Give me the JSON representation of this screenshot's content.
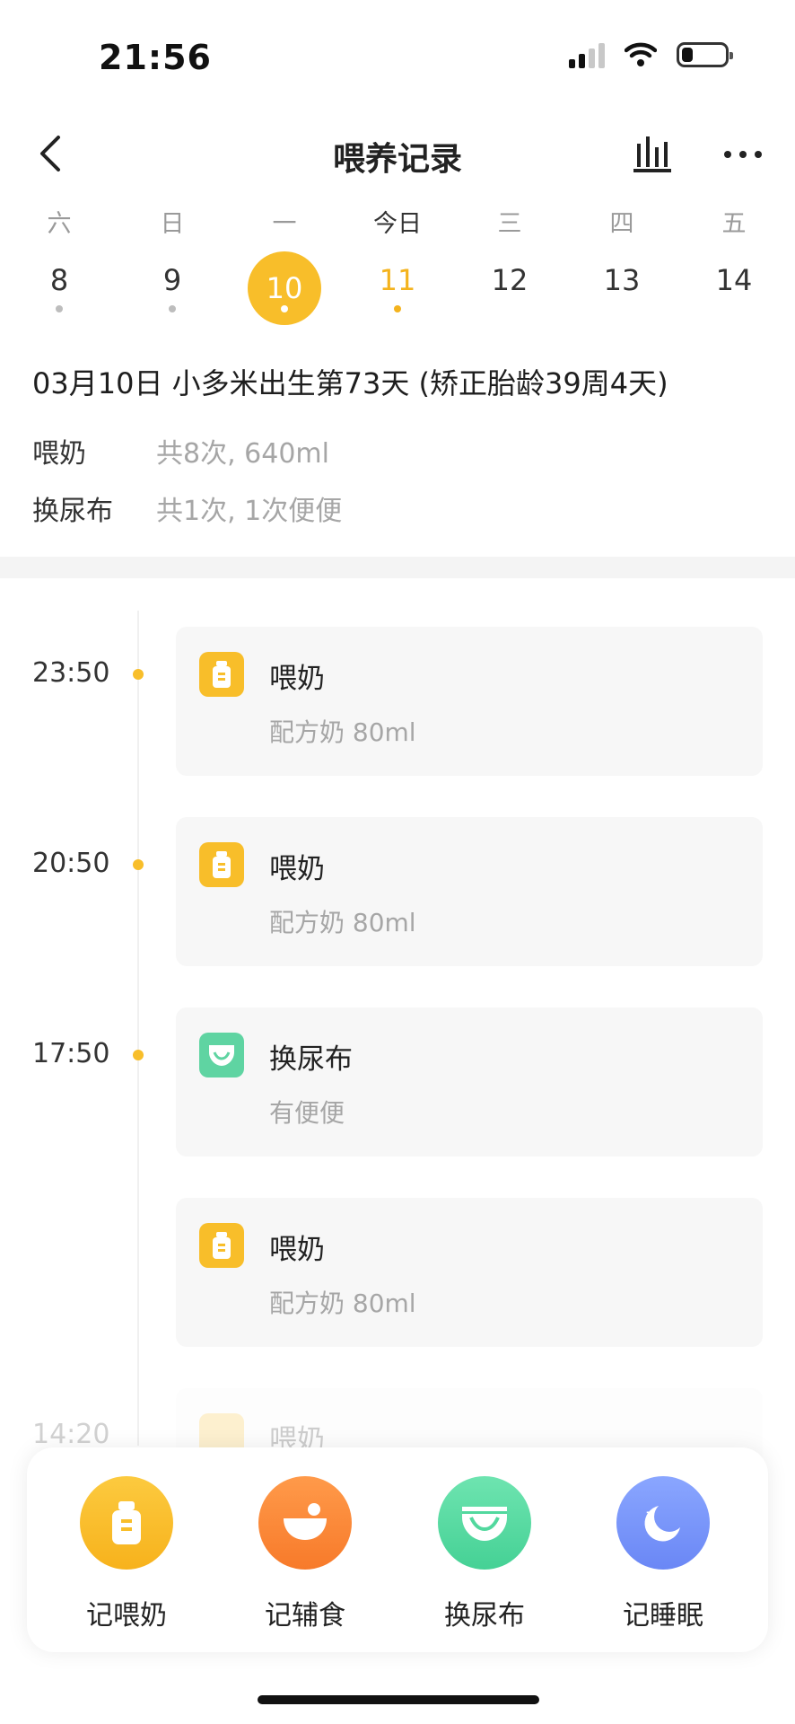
{
  "status": {
    "time": "21:56",
    "battery_level": 0.25
  },
  "nav": {
    "title": "喂养记录",
    "icons": [
      "back-icon",
      "bar-chart-icon",
      "more-icon"
    ]
  },
  "week": {
    "days": [
      {
        "weekday": "六",
        "date": "8",
        "dot": "gray"
      },
      {
        "weekday": "日",
        "date": "9",
        "dot": "gray"
      },
      {
        "weekday": "一",
        "date": "10",
        "dot": "white",
        "selected": true
      },
      {
        "weekday": "今日",
        "date": "11",
        "dot": "yellow",
        "today": true
      },
      {
        "weekday": "三",
        "date": "12"
      },
      {
        "weekday": "四",
        "date": "13"
      },
      {
        "weekday": "五",
        "date": "14"
      }
    ]
  },
  "summary": {
    "title": "03月10日  小多米出生第73天 (矫正胎龄39周4天)",
    "rows": [
      {
        "label": "喂奶",
        "value": "共8次, 640ml"
      },
      {
        "label": "换尿布",
        "value": "共1次, 1次便便"
      }
    ]
  },
  "timeline": [
    {
      "time": "23:50",
      "type": "feed",
      "title": "喂奶",
      "detail": "配方奶 80ml"
    },
    {
      "time": "20:50",
      "type": "feed",
      "title": "喂奶",
      "detail": "配方奶 80ml"
    },
    {
      "time": "17:50",
      "type": "diaper",
      "title": "换尿布",
      "detail": "有便便"
    },
    {
      "time": "",
      "type": "feed",
      "title": "喂奶",
      "detail": "配方奶 80ml"
    },
    {
      "time": "14:20",
      "type": "feed",
      "title": "喂奶",
      "detail": ""
    }
  ],
  "actions": [
    {
      "label": "记喂奶",
      "icon": "bottle-icon",
      "color": "#f8be2a"
    },
    {
      "label": "记辅食",
      "icon": "bowl-icon",
      "color": "#f7832f"
    },
    {
      "label": "换尿布",
      "icon": "diaper-icon",
      "color": "#52d89e"
    },
    {
      "label": "记睡眠",
      "icon": "moon-icon",
      "color": "#7594f8"
    }
  ],
  "colors": {
    "accent": "#f8be2a",
    "feed": "#f8be2a",
    "diaper": "#5fd4a2"
  }
}
